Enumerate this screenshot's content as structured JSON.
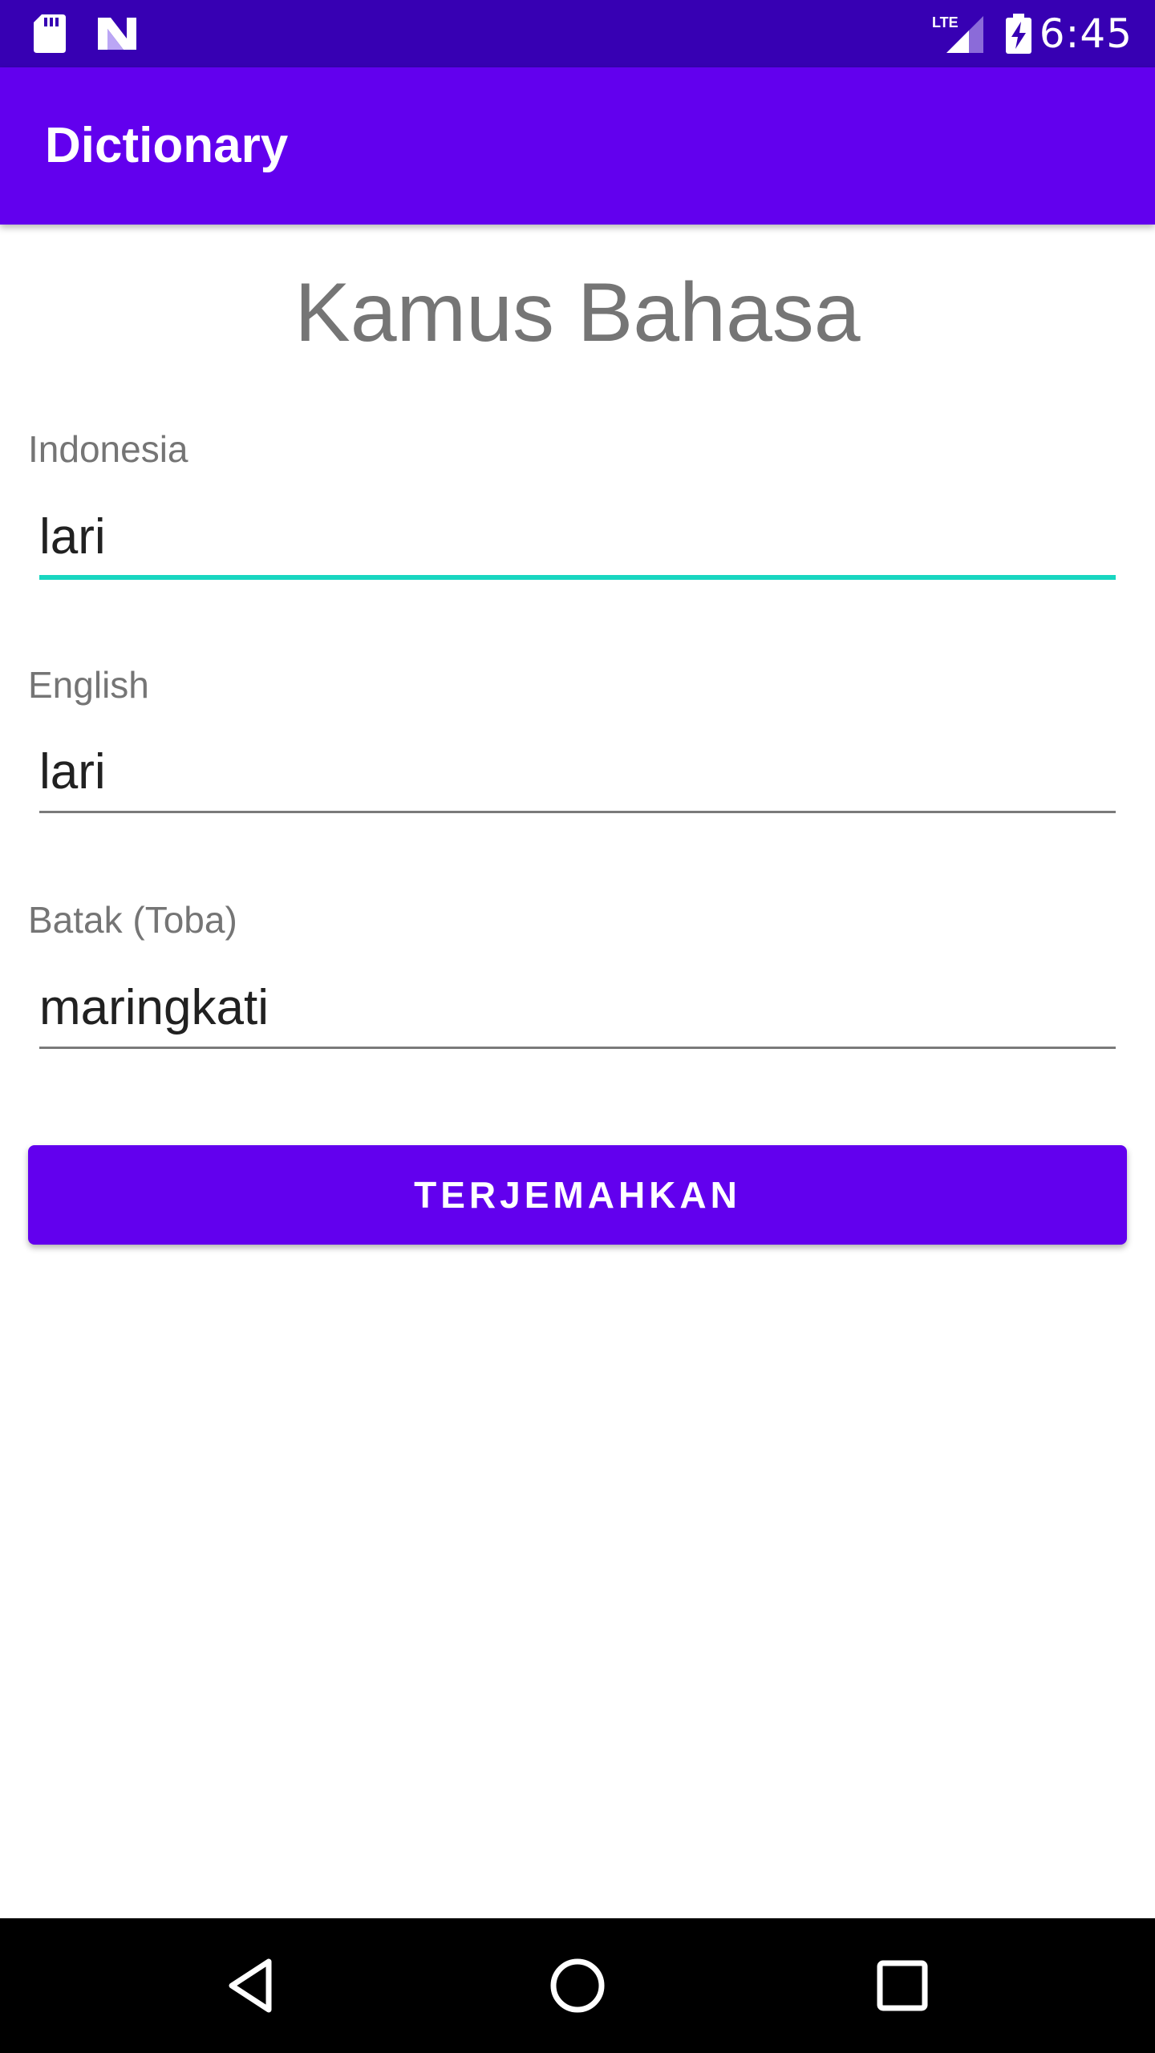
{
  "status_bar": {
    "time": "6:45",
    "network_label": "LTE",
    "icons": [
      "sd-card-icon",
      "n-logo-icon",
      "lte-signal-icon",
      "battery-charging-icon"
    ]
  },
  "app_bar": {
    "title": "Dictionary"
  },
  "main": {
    "heading": "Kamus Bahasa",
    "fields": [
      {
        "label": "Indonesia",
        "value": "lari",
        "focused": true
      },
      {
        "label": "English",
        "value": "lari",
        "focused": false
      },
      {
        "label": "Batak (Toba)",
        "value": "maringkati",
        "focused": false
      }
    ],
    "translate_button_label": "TERJEMAHKAN"
  },
  "nav_bar": {
    "icons": [
      "back-icon",
      "home-icon",
      "recents-icon"
    ]
  },
  "colors": {
    "status_bar": "#3700b3",
    "primary": "#6200ee",
    "focus_accent": "#18d6c0",
    "label_gray": "#757575"
  }
}
